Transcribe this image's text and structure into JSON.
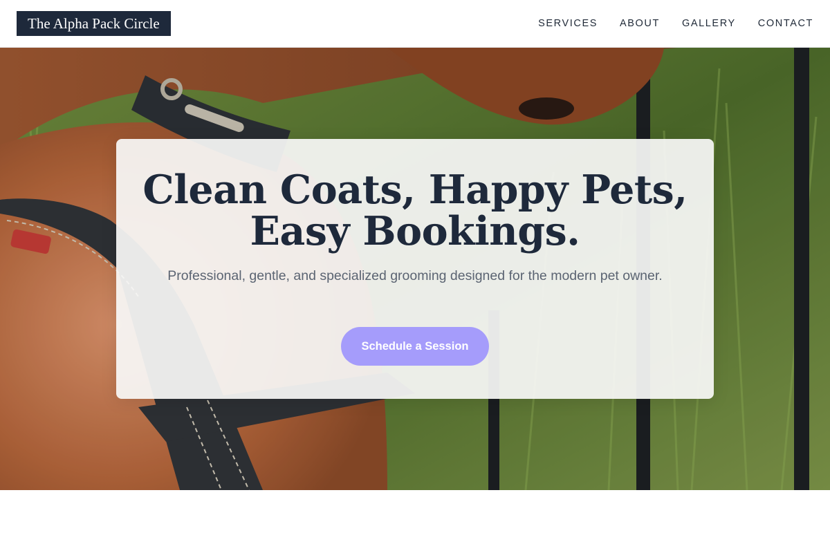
{
  "header": {
    "logo_text": "The Alpha Pack Circle",
    "nav": [
      {
        "label": "SERVICES"
      },
      {
        "label": "ABOUT"
      },
      {
        "label": "GALLERY"
      },
      {
        "label": "CONTACT"
      }
    ]
  },
  "hero": {
    "headline_line1": "Clean Coats, Happy Pets,",
    "headline_line2": "Easy Bookings.",
    "subtext": "Professional, gentle, and specialized grooming designed for the modern pet owner.",
    "cta_label": "Schedule a Session",
    "colors": {
      "heading": "#1e293b",
      "cta_background": "#a59cfb",
      "logo_background": "#1e293b"
    }
  }
}
